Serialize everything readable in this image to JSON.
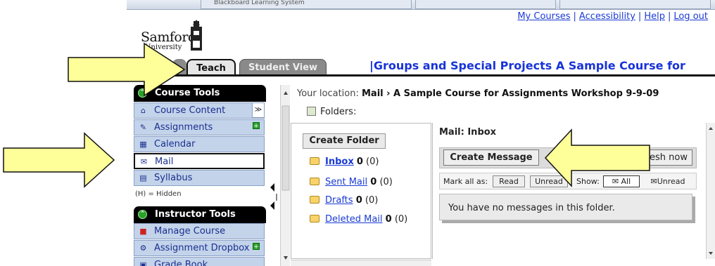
{
  "browser_tabs": [
    "Blackboard Learning System",
    "",
    ""
  ],
  "header": {
    "links": [
      "My Courses",
      "Accessibility",
      "Help",
      "Log out"
    ],
    "logo_text": "Samford",
    "logo_sub": "University",
    "course_title": "|Groups and Special Projects A Sample Course for",
    "tabs": {
      "teach": "Teach",
      "student_view": "Student View"
    }
  },
  "leftnav": {
    "course_tools_title": "Course Tools",
    "course_tools": [
      {
        "label": "Course Content",
        "icon": "home-icon"
      },
      {
        "label": "Assignments",
        "icon": "assignment-icon"
      },
      {
        "label": "Calendar",
        "icon": "calendar-icon"
      },
      {
        "label": "Mail",
        "icon": "mail-icon",
        "active": true
      },
      {
        "label": "Syllabus",
        "icon": "syllabus-icon"
      }
    ],
    "hidden_note": "(H) = Hidden",
    "instructor_tools_title": "Instructor Tools",
    "instructor_tools": [
      {
        "label": "Manage Course",
        "icon": "manage-icon"
      },
      {
        "label": "Assignment Dropbox",
        "icon": "dropbox-icon"
      },
      {
        "label": "Grade Book",
        "icon": "gradebook-icon"
      }
    ]
  },
  "location": {
    "prefix": "Your location:",
    "path": "Mail › A Sample Course for Assignments Workshop 9-9-09"
  },
  "folders": {
    "label": "Folders:",
    "create_button": "Create Folder",
    "items": [
      {
        "name": "Inbox",
        "unread": "0",
        "total": "(0)"
      },
      {
        "name": "Sent Mail",
        "unread": "0",
        "total": "(0)"
      },
      {
        "name": "Drafts",
        "unread": "0",
        "total": "(0)"
      },
      {
        "name": "Deleted Mail",
        "unread": "0",
        "total": "(0)"
      }
    ]
  },
  "mail": {
    "title": "Mail: Inbox",
    "create_message": "Create Message",
    "refresh": "esh now",
    "mark_all_as": "Mark all as:",
    "read_btn": "Read",
    "unread_btn": "Unread",
    "show": "Show:",
    "show_all": "All",
    "show_unread": "Unread",
    "empty_text": "You have no messages in this folder."
  },
  "colors": {
    "arrow_fill": "#ffff99",
    "link": "#1a3bd4",
    "nav_bg": "#c3d3ea"
  }
}
